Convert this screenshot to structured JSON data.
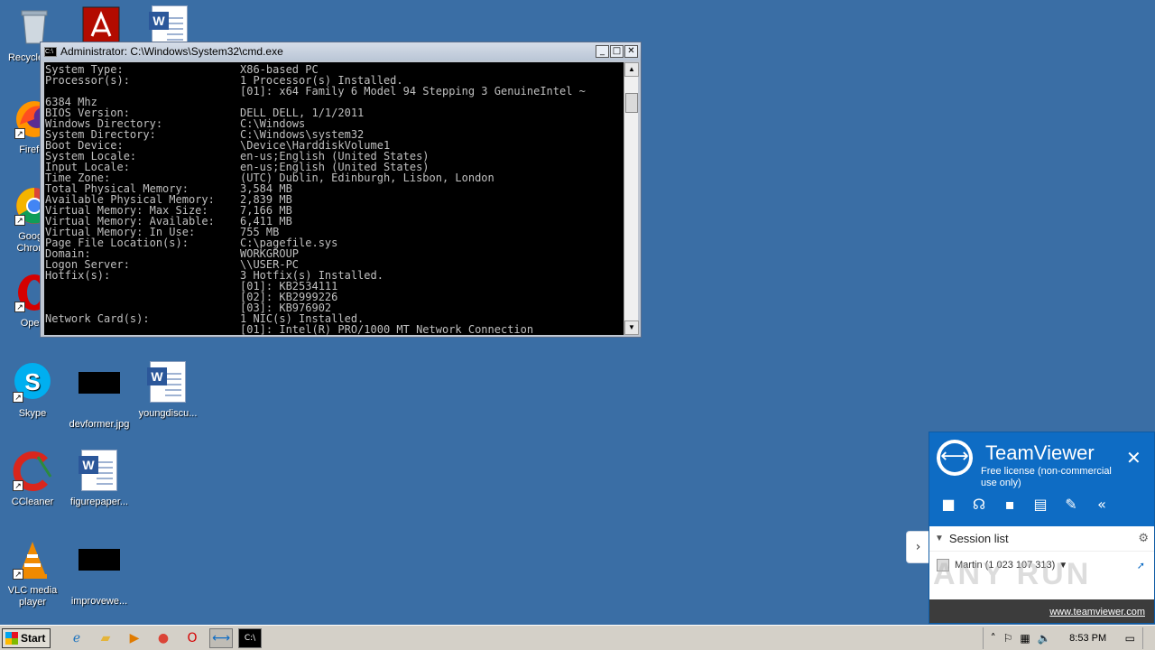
{
  "desktop": {
    "icons": [
      {
        "label": "Recycle Bin"
      },
      {
        "label": "Firefox"
      },
      {
        "label": "Google Chrome"
      },
      {
        "label": "Opera"
      },
      {
        "label": "Skype"
      },
      {
        "label": "devformer.jpg"
      },
      {
        "label": "youngdiscu..."
      },
      {
        "label": "CCleaner"
      },
      {
        "label": "figurepaper..."
      },
      {
        "label": "VLC media player"
      },
      {
        "label": "improvewe..."
      }
    ]
  },
  "cmd": {
    "title": "Administrator: C:\\Windows\\System32\\cmd.exe",
    "lines": [
      {
        "k": "System Type:",
        "v": "X86-based PC"
      },
      {
        "k": "Processor(s):",
        "v": "1 Processor(s) Installed."
      },
      {
        "k": "",
        "v": "[01]: x64 Family 6 Model 94 Stepping 3 GenuineIntel ~"
      },
      {
        "k": "6384 Mhz",
        "v": ""
      },
      {
        "k": "BIOS Version:",
        "v": "DELL DELL, 1/1/2011"
      },
      {
        "k": "Windows Directory:",
        "v": "C:\\Windows"
      },
      {
        "k": "System Directory:",
        "v": "C:\\Windows\\system32"
      },
      {
        "k": "Boot Device:",
        "v": "\\Device\\HarddiskVolume1"
      },
      {
        "k": "System Locale:",
        "v": "en-us;English (United States)"
      },
      {
        "k": "Input Locale:",
        "v": "en-us;English (United States)"
      },
      {
        "k": "Time Zone:",
        "v": "(UTC) Dublin, Edinburgh, Lisbon, London"
      },
      {
        "k": "Total Physical Memory:",
        "v": "3,584 MB"
      },
      {
        "k": "Available Physical Memory:",
        "v": "2,839 MB"
      },
      {
        "k": "Virtual Memory: Max Size:",
        "v": "7,166 MB"
      },
      {
        "k": "Virtual Memory: Available:",
        "v": "6,411 MB"
      },
      {
        "k": "Virtual Memory: In Use:",
        "v": "755 MB"
      },
      {
        "k": "Page File Location(s):",
        "v": "C:\\pagefile.sys"
      },
      {
        "k": "Domain:",
        "v": "WORKGROUP"
      },
      {
        "k": "Logon Server:",
        "v": "\\\\USER-PC"
      },
      {
        "k": "Hotfix(s):",
        "v": "3 Hotfix(s) Installed."
      },
      {
        "k": "",
        "v": "[01]: KB2534111"
      },
      {
        "k": "",
        "v": "[02]: KB2999226"
      },
      {
        "k": "",
        "v": "[03]: KB976902"
      },
      {
        "k": "Network Card(s):",
        "v": "1 NIC(s) Installed."
      },
      {
        "k": "",
        "v": "[01]: Intel(R) PRO/1000 MT Network Connection"
      }
    ],
    "btn_min": "_",
    "btn_max": "□",
    "btn_close": "✕"
  },
  "teamviewer": {
    "title": "TeamViewer",
    "subtitle": "Free license (non-commercial use only)",
    "section": "Session list",
    "session_item": "Martin (1 023 107 313)",
    "footer_link": "www.teamviewer.com",
    "watermark": "ANY RUN"
  },
  "taskbar": {
    "start_label": "Start",
    "clock": "8:53 PM"
  }
}
